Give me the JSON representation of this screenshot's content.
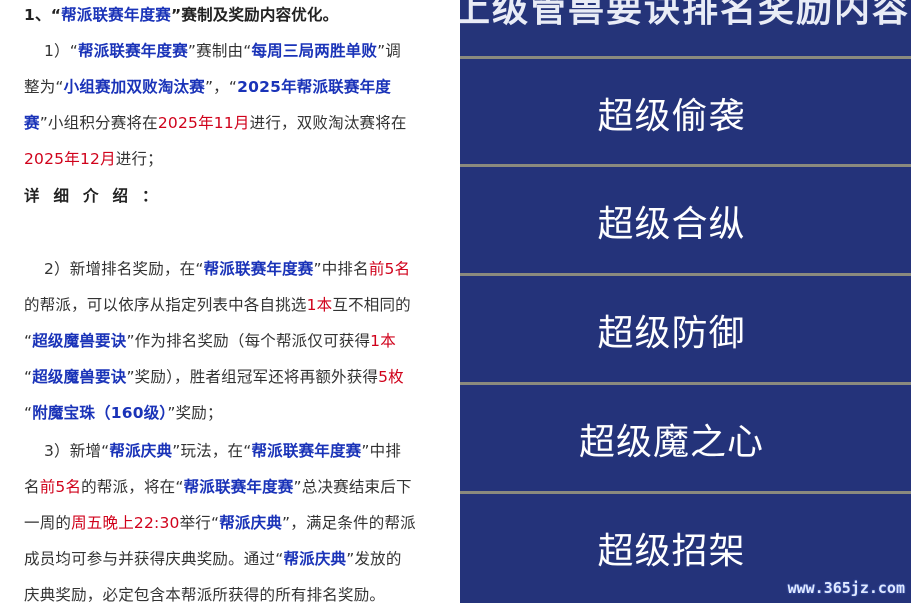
{
  "doc": {
    "section1": {
      "num": "1、",
      "q1": "“",
      "event": "帮派联赛年度赛",
      "q2": "”",
      "rest": "赛制及奖励内容优化。"
    },
    "p1": {
      "l1": {
        "a": "1）“",
        "b": "帮派联赛年度赛",
        "c": "”赛制由“",
        "d": "每周三局两胜单败",
        "e": "”调"
      },
      "l2": {
        "a": "整为“",
        "b": "小组赛加双败淘汰赛",
        "c": "”，“",
        "d": "2025年帮派联赛年度"
      },
      "l3": {
        "a": "赛",
        "b": "”小组积分赛将在",
        "c": "2025年11月",
        "d": "进行，双败淘汰赛将在"
      },
      "l4": {
        "a": "2025年12月",
        "b": "进行；"
      }
    },
    "details": "详细介绍：",
    "p2": {
      "l1": {
        "a": "2）新增排名奖励，在“",
        "b": "帮派联赛年度赛",
        "c": "”中排名",
        "d": "前5名"
      },
      "l2": {
        "a": "的帮派，可以依序从指定列表中各自挑选",
        "b": "1本",
        "c": "互不相同的"
      },
      "l3": {
        "a": "“",
        "b": "超级魔兽要诀",
        "c": "”作为排名奖励（每个帮派仅可获得",
        "d": "1本"
      },
      "l4": {
        "a": "“",
        "b": "超级魔兽要诀",
        "c": "”奖励），胜者组冠军还将再额外获得",
        "d": "5枚"
      },
      "l5": {
        "a": "“",
        "b": "附魔宝珠（160级）",
        "c": "”奖励；"
      }
    },
    "p3": {
      "l1": {
        "a": "3）新增“",
        "b": "帮派庆典",
        "c": "”玩法，在“",
        "d": "帮派联赛年度赛",
        "e": "”中排"
      },
      "l2": {
        "a": "名",
        "b": "前5名",
        "c": "的帮派，将在“",
        "d": "帮派联赛年度赛",
        "e": "”总决赛结束后下"
      },
      "l3": {
        "a": "一周的",
        "b": "周五晚上22:30",
        "c": "举行“",
        "d": "帮派庆典",
        "e": "”，满足条件的帮派"
      },
      "l4": {
        "a": "成员均可参与并获得庆典奖励。通过“",
        "b": "帮派庆典",
        "c": "”发放的"
      },
      "l5": {
        "a": "庆典奖励，必定包含本帮派所获得的所有排名奖励。"
      }
    }
  },
  "skills_panel": {
    "top_text": "上级管兽要诀排名奖励内容",
    "items": [
      "超级偷袭",
      "超级合纵",
      "超级防御",
      "超级魔之心",
      "超级招架"
    ],
    "colors": {
      "background": "#24337a",
      "divider": "#8a8a7e",
      "text": "#ffffff"
    }
  },
  "watermark": "www.365jz.com"
}
